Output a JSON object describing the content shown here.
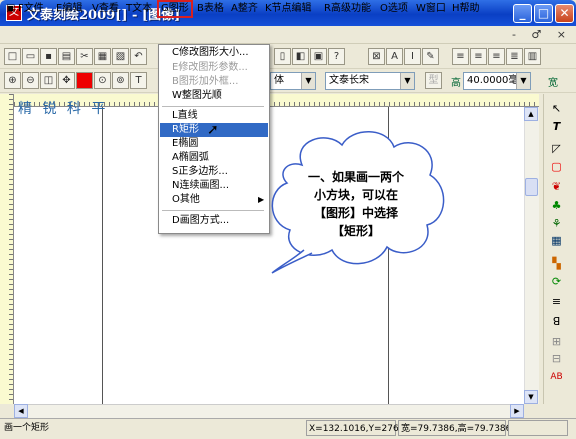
{
  "window": {
    "title": "文泰刻绘2009[] - [图像]",
    "icon": "app-icon",
    "buttons": {
      "minimize": "_",
      "maximize": "□",
      "close": "✕"
    }
  },
  "menubar": {
    "items": [
      {
        "label": "F文件"
      },
      {
        "label": "E编辑"
      },
      {
        "label": "V查看"
      },
      {
        "label": "T文本"
      },
      {
        "label": "G图形"
      },
      {
        "label": "B表格"
      },
      {
        "label": "A整齐"
      },
      {
        "label": "K节点编辑"
      },
      {
        "label": "R高级功能"
      },
      {
        "label": "O选项"
      },
      {
        "label": "W窗口"
      },
      {
        "label": "H帮助"
      }
    ],
    "mdi_controls": "- ♂ ×"
  },
  "toolbar2": {
    "font_combo": "文泰长宋",
    "font_prefix": "体",
    "height_label": "高",
    "height_value": "40.0000毫米",
    "width_label": "宽"
  },
  "graphics_menu": {
    "items": [
      {
        "label": "C修改图形大小...",
        "enabled": false
      },
      {
        "label": "E修改图形参数...",
        "enabled": false
      },
      {
        "label": "B图形加外框...",
        "enabled": false
      },
      {
        "label": "W整图光顺",
        "enabled": true
      },
      {
        "label": "L直线",
        "enabled": true
      },
      {
        "label": "R矩形",
        "enabled": true,
        "selected": true
      },
      {
        "label": "E椭圆",
        "enabled": true
      },
      {
        "label": "A椭圆弧",
        "enabled": true
      },
      {
        "label": "S正多边形...",
        "enabled": true
      },
      {
        "label": "N连续画图...",
        "enabled": true
      },
      {
        "label": "O其他",
        "enabled": true,
        "submenu": "▶"
      },
      {
        "label": "D画图方式...",
        "enabled": true
      }
    ]
  },
  "annotation": {
    "lines": [
      "一、如果画一两个",
      "小方块，可以在",
      "【图形】中选择",
      "【矩形】"
    ]
  },
  "watermark": "精 锐 科 平",
  "statusbar": {
    "message": "画一个矩形",
    "coords": "X=132.1016,Y=276.€",
    "size": "宽=79.7386,高=79.7386"
  },
  "colors": {
    "titlebar": "#0a3fc4",
    "selection": "#316ac5",
    "highlight_box": "#d82020"
  }
}
